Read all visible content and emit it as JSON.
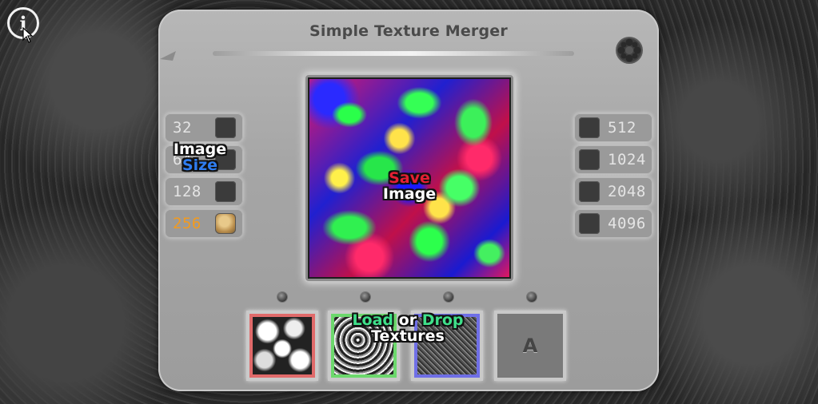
{
  "app": {
    "title": "Simple Texture Merger"
  },
  "icons": {
    "info": "info-circle-icon",
    "cursor": "mouse-pointer-icon",
    "settings": "gear-icon"
  },
  "info_glyph": "i",
  "size_buttons": {
    "left": [
      {
        "label": "32",
        "selected": false
      },
      {
        "label": "64",
        "selected": false
      },
      {
        "label": "128",
        "selected": false
      },
      {
        "label": "256",
        "selected": true
      }
    ],
    "right": [
      {
        "label": "512",
        "selected": false
      },
      {
        "label": "1024",
        "selected": false
      },
      {
        "label": "2048",
        "selected": false
      },
      {
        "label": "4096",
        "selected": false
      }
    ]
  },
  "image_size_label": {
    "line1": "Image",
    "line2": "Size"
  },
  "save_label": {
    "line1": "Save",
    "line2": "Image"
  },
  "load_label": {
    "word1": "Load",
    "word2": "or",
    "word3": "Drop",
    "line2": "Textures"
  },
  "texture_slots": [
    {
      "channel": "red",
      "color": "#e06a6a"
    },
    {
      "channel": "green",
      "color": "#6cd86c"
    },
    {
      "channel": "blue",
      "color": "#6f6fe6"
    },
    {
      "channel": "alpha",
      "letter": "A"
    }
  ],
  "colors": {
    "selected_size": "#f39a1e",
    "label_blue": "#2f7df0",
    "label_red": "#e52033",
    "label_green": "#3fe08a"
  }
}
